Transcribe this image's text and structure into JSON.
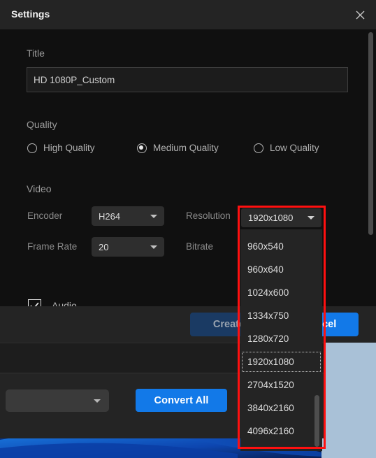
{
  "dialog": {
    "title": "Settings",
    "close_icon": "close-icon",
    "title_section": {
      "label": "Title",
      "value": "HD 1080P_Custom",
      "placeholder": "Title"
    },
    "quality_section": {
      "label": "Quality",
      "options": [
        {
          "label": "High Quality",
          "checked": false
        },
        {
          "label": "Medium Quality",
          "checked": true
        },
        {
          "label": "Low Quality",
          "checked": false
        }
      ]
    },
    "video_section": {
      "label": "Video",
      "encoder": {
        "label": "Encoder",
        "value": "H264"
      },
      "frame_rate": {
        "label": "Frame Rate",
        "value": "20"
      },
      "resolution": {
        "label": "Resolution",
        "value": "1920x1080"
      },
      "bitrate": {
        "label": "Bitrate",
        "value": ""
      }
    },
    "audio_section": {
      "label": "Audio",
      "checked": true,
      "check_icon": "checkmark-icon"
    },
    "footer": {
      "create_label": "Create",
      "cancel_label": "Cancel"
    }
  },
  "resolution_dropdown": {
    "selected": "1920x1080",
    "caret_icon": "chevron-down-icon",
    "focused_option": "1920x1080",
    "options": [
      "960x540",
      "960x640",
      "1024x600",
      "1334x750",
      "1280x720",
      "1920x1080",
      "2704x1520",
      "3840x2160",
      "4096x2160"
    ]
  },
  "background_app": {
    "format_select_value": "",
    "convert_all_label": "Convert All"
  },
  "colors": {
    "accent_blue": "#1279e8",
    "create_disabled_blue": "#1a3a63",
    "annotation_red": "#ff1010",
    "dialog_bg": "#101010",
    "titlebar_bg": "#242424",
    "desktop_bg": "#a9c1d7"
  }
}
